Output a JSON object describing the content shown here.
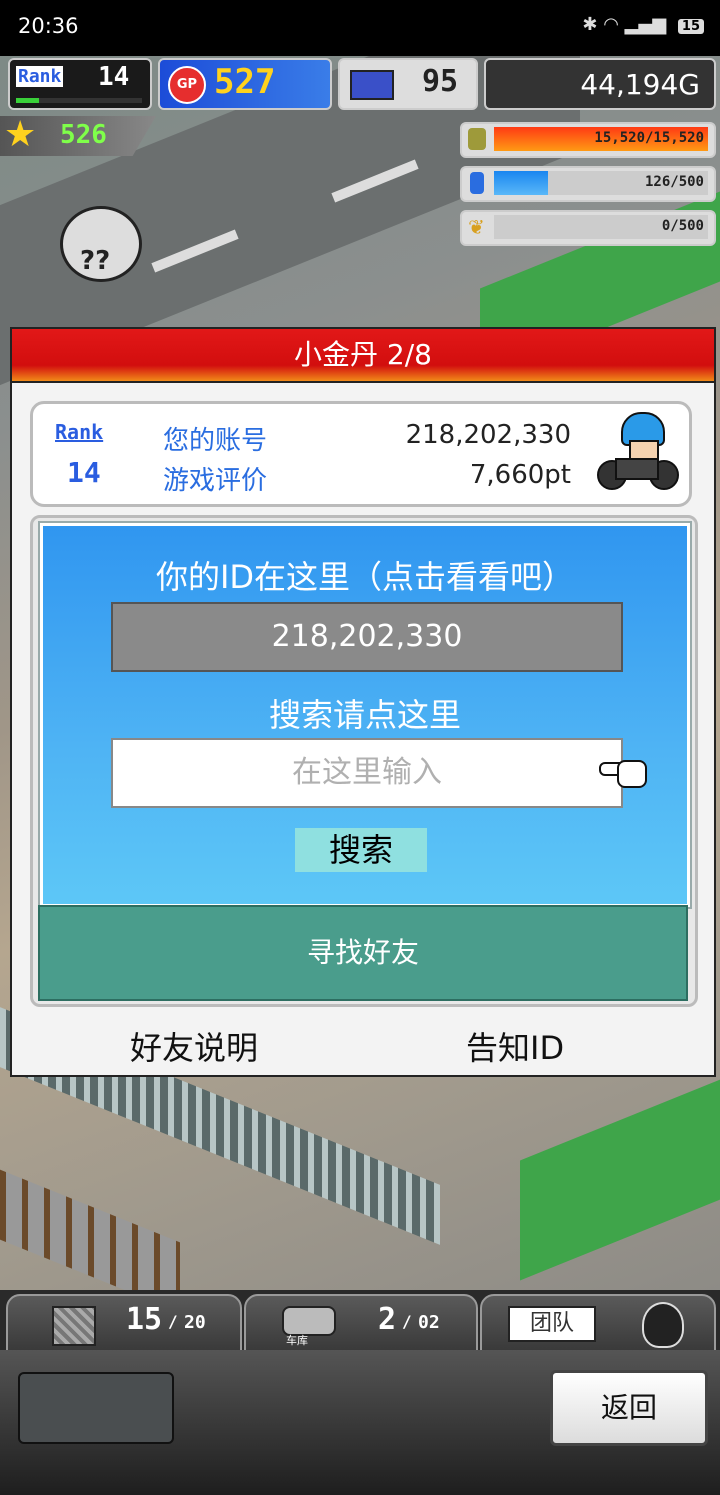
{
  "status_bar": {
    "time": "20:36",
    "battery": "15"
  },
  "hud": {
    "rank_label": "Rank",
    "rank_value": "14",
    "gp_icon_label": "GP",
    "gp_value": "527",
    "computer_value": "95",
    "money": "44,194G",
    "star_value": "526",
    "resource_1": "15,520/15,520",
    "resource_1_fill": 1.0,
    "resource_2": "126/500",
    "resource_2_fill": 0.252,
    "resource_3": "0/500",
    "resource_3_fill": 0.0
  },
  "dialog": {
    "title": "小金丹 2/8",
    "profile": {
      "rank_label": "Rank",
      "rank_value": "14",
      "account_label": "您的账号",
      "account_value": "218,202,330",
      "rating_label": "游戏评价",
      "rating_value": "7,660pt"
    },
    "id_prompt": "你的ID在这里（点击看看吧）",
    "id_value": "218,202,330",
    "search_prompt": "搜索请点这里",
    "search_placeholder": "在这里输入",
    "search_button": "搜索",
    "find_friends_button": "寻找好友",
    "friend_help_link": "好友说明",
    "share_id_link": "告知ID"
  },
  "bottom": {
    "tab1_count": "15",
    "tab1_total": "20",
    "tab2_label": "车库",
    "tab2_count": "2",
    "tab2_total": "02",
    "tab3_label": "团队",
    "back_button": "返回"
  },
  "colors": {
    "title_red": "#e21818",
    "panel_blue": "#3096f0",
    "find_button": "#4a9d8c"
  }
}
